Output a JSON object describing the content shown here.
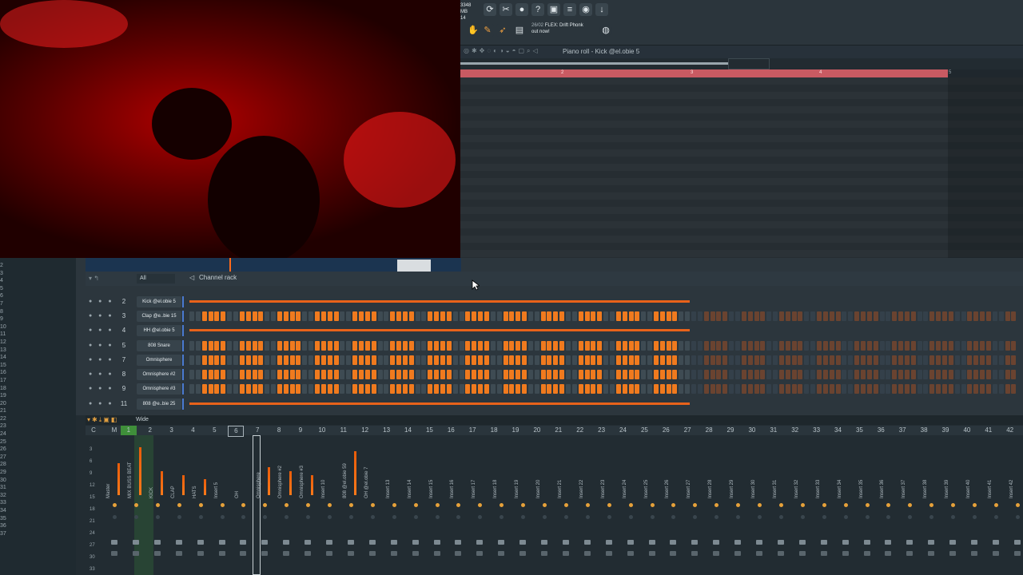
{
  "toolbar": {
    "cpu_mem": "3348 MB",
    "cpu_poly": "14",
    "hint_counter": "26/02",
    "hint_title": "FLEX: Drift Phonk",
    "hint_sub": "out now!"
  },
  "piano_roll": {
    "title": "Piano roll - Kick @el.obie 5",
    "bar_numbers": [
      "2",
      "3",
      "4",
      "5"
    ]
  },
  "channel_rack": {
    "filter_label": "All",
    "title": "Channel rack",
    "channels": [
      {
        "num": "2",
        "name": "Kick @el.obie 5",
        "mode": "roll"
      },
      {
        "num": "3",
        "name": "Clap @e..bie 15",
        "mode": "steps"
      },
      {
        "num": "4",
        "name": "HH @el.obie 5",
        "mode": "roll"
      },
      {
        "num": "5",
        "name": "808 Snare",
        "mode": "steps"
      },
      {
        "num": "7",
        "name": "Omnisphere",
        "mode": "steps"
      },
      {
        "num": "8",
        "name": "Omnisphere #2",
        "mode": "steps"
      },
      {
        "num": "9",
        "name": "Omnisphere #3",
        "mode": "steps"
      },
      {
        "num": "11",
        "name": "808 @e..bie 25",
        "mode": "roll"
      }
    ]
  },
  "mixer": {
    "preset": "Wide",
    "track_numbers": [
      "C",
      "M",
      "1",
      "2",
      "3",
      "4",
      "5",
      "6",
      "7",
      "8",
      "9",
      "10",
      "11",
      "12",
      "13",
      "14",
      "15",
      "16",
      "17",
      "18",
      "19",
      "20",
      "21",
      "22",
      "23",
      "24",
      "25",
      "26",
      "27",
      "28",
      "29",
      "30",
      "31",
      "32",
      "33",
      "34",
      "35",
      "36",
      "37",
      "38",
      "39",
      "40",
      "41",
      "42"
    ],
    "strip_labels": [
      "Master",
      "MIX BUSS BEAT",
      "KICK",
      "CLAP",
      "HATS",
      "Insert 5",
      "OH",
      "Omnisphere",
      "Omnisphere #2",
      "Omnisphere #3",
      "Insert 10",
      "808 @el.obie 59",
      "OH @el.obie 7",
      "Insert 13",
      "Insert 14",
      "Insert 15",
      "Insert 16",
      "Insert 17",
      "Insert 18",
      "Insert 19",
      "Insert 20",
      "Insert 21",
      "Insert 22",
      "Insert 23",
      "Insert 24",
      "Insert 25",
      "Insert 26",
      "Insert 27",
      "Insert 28",
      "Insert 29",
      "Insert 30",
      "Insert 31",
      "Insert 32",
      "Insert 33",
      "Insert 34",
      "Insert 35",
      "Insert 36",
      "Insert 37",
      "Insert 38",
      "Insert 39",
      "Insert 40",
      "Insert 41",
      "Insert 42"
    ],
    "left_scale": [
      "3",
      "6",
      "9",
      "12",
      "15",
      "18",
      "21",
      "24",
      "27",
      "30",
      "33"
    ]
  },
  "side_list": [
    "2",
    "3",
    "4",
    "5",
    "6",
    "7",
    "8",
    "9",
    "10",
    "11",
    "12",
    "13",
    "14",
    "15",
    "16",
    "17",
    "18",
    "19",
    "20",
    "21",
    "22",
    "23",
    "24",
    "25",
    "26",
    "27",
    "28",
    "29",
    "30",
    "31",
    "32",
    "33",
    "34",
    "35",
    "36",
    "37"
  ]
}
